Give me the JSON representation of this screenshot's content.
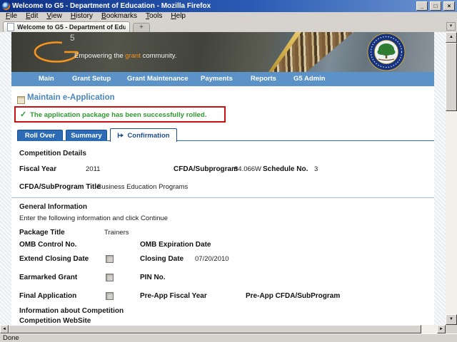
{
  "colors": {
    "accent_orange": "#F7941D",
    "nav_blue": "#5B93C8",
    "tab_blue": "#2D6CB5",
    "heading_blue": "#4A86BB",
    "success_green": "#2E9A2E",
    "alert_red": "#CC1111",
    "separator_blue": "#9CC2DD"
  },
  "icons": {
    "check": "✓",
    "minimize": "_",
    "restore": "□",
    "close": "×",
    "scroll_up": "▲",
    "scroll_down": "▼",
    "scroll_left": "◄",
    "scroll_right": "►",
    "tab_dropdown": "▾",
    "new_tab": "+"
  },
  "window": {
    "title": "Welcome to G5 - Department of Education - Mozilla Firefox",
    "menu": [
      "File",
      "Edit",
      "View",
      "History",
      "Bookmarks",
      "Tools",
      "Help"
    ],
    "tab_title": "Welcome to G5 - Department of Edu...",
    "status": "Done"
  },
  "banner": {
    "logo_number": "5",
    "tagline_pre": "Empowering the ",
    "tagline_accent": "grant",
    "tagline_post": " community."
  },
  "nav": {
    "items": [
      "Main",
      "Grant Setup",
      "Grant Maintenance",
      "Payments",
      "Reports",
      "G5 Admin"
    ]
  },
  "page": {
    "heading": "Maintain e-Application",
    "success_message": "The application package has been successfully rolled.",
    "tabs": [
      {
        "label": "Roll Over",
        "active": false
      },
      {
        "label": "Summary",
        "active": false
      },
      {
        "label": "Confirmation",
        "active": true
      }
    ],
    "competition_details": {
      "title": "Competition Details",
      "fiscal_year_label": "Fiscal Year",
      "fiscal_year": "2011",
      "cfda_label": "CFDA/Subprogram",
      "cfda": "84.066W",
      "schedule_label": "Schedule No.",
      "schedule": "3",
      "program_title_label": "CFDA/SubProgram Title",
      "program_title": "Business Education Programs"
    },
    "general_information": {
      "title": "General Information",
      "instructions": "Enter the following information and click Continue",
      "package_title_label": "Package Title",
      "package_title": "Trainers",
      "omb_control_label": "OMB Control No.",
      "omb_expiration_label": "OMB Expiration Date",
      "extend_closing_label": "Extend Closing Date",
      "extend_closing_checked": false,
      "closing_date_label": "Closing Date",
      "closing_date": "07/20/2010",
      "earmarked_label": "Earmarked Grant",
      "earmarked_checked": false,
      "pin_label": "PIN No.",
      "final_application_label": "Final Application",
      "final_application_checked": false,
      "preapp_fiscal_year_label": "Pre-App Fiscal Year",
      "preapp_cfda_label": "Pre-App CFDA/SubProgram",
      "info_about_competition_label": "Information about Competition",
      "competition_website_label": "Competition WebSite"
    }
  }
}
